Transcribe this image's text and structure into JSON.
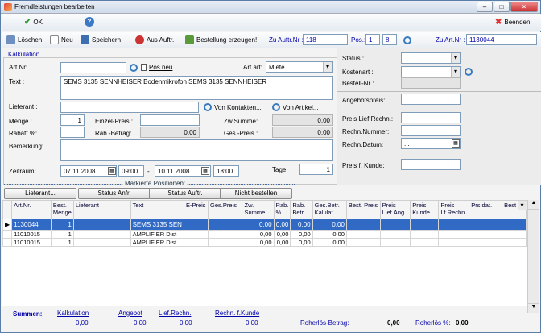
{
  "window": {
    "title": "Fremdleistungen bearbeiten"
  },
  "top": {
    "ok": "OK",
    "help": "?",
    "end": "Beenden"
  },
  "toolbar": {
    "delete": "Löschen",
    "new": "Neu",
    "save": "Speichern",
    "from_order": "Aus Auftr.",
    "create_order": "Bestellung erzeugen!",
    "order_no_label": "Zu Auftr.Nr :",
    "order_no": "118",
    "pos_label": "Pos.:",
    "pos1": "1",
    "pos2": "8",
    "art_no_label": "Zu Art.Nr :",
    "art_no": "1130044"
  },
  "form": {
    "section": "Kalkulation",
    "art_nr_label": "Art.Nr:",
    "pos_neu": "Pos.neu",
    "art_art_label": "Art.art:",
    "art_art": "Miete",
    "text_label": "Text :",
    "text": "SEMS 3135 SENNHEISER Bodenmikrofon SEMS 3135 SENNHEISER",
    "lieferant_label": "Lieferant :",
    "von_kontakten": "Von Kontakten...",
    "von_artikel": "Von Artikel...",
    "menge_label": "Menge :",
    "menge": "1",
    "einzelpreis_label": "Einzel-Preis :",
    "zw_summe_label": "Zw.Summe:",
    "zw_summe": "0,00",
    "rabatt_label": "Rabatt %:",
    "rab_betrag_label": "Rab.-Betrag:",
    "rab_betrag": "0,00",
    "ges_preis_label": "Ges.-Preis :",
    "ges_preis": "0,00",
    "bemerkung_label": "Bemerkung:",
    "zeitraum_label": "Zeitraum:",
    "date_from": "07.11.2008",
    "time_from": "09:00",
    "dash": "-",
    "date_to": "10.11.2008",
    "time_to": "18:00",
    "tage_label": "Tage:",
    "tage": "1"
  },
  "right": {
    "status_label": "Status :",
    "kostenart_label": "Kostenart :",
    "bestell_label": "Bestell-Nr :",
    "angebotspreis_label": "Angebotspreis:",
    "preis_lief_label": "Preis Lief.Rechn.:",
    "rechn_nummer_label": "Rechn.Nummer:",
    "rechn_datum_label": "Rechn.Datum:",
    "rechn_datum": ". .",
    "preis_kunde_label": "Preis f. Kunde:"
  },
  "marked": {
    "title": "Markierte Positionen:",
    "buttons": [
      "Lieferant...",
      "Status Anfr.",
      "Status Auftr.",
      "Nicht bestellen"
    ]
  },
  "grid": {
    "headers": [
      "",
      "Art.Nr.",
      "Best. Menge",
      "Lieferant",
      "Text",
      "E-Preis",
      "Ges.Preis",
      "Zw. Summe",
      "Rab. %",
      "Rab. Betr.",
      "Ges.Betr. Kalulat.",
      "Best. Preis",
      "Preis Lief.Ang.",
      "Preis Kunde",
      "Preis Lf.Rechn.",
      "Prs.dat.",
      "Best"
    ],
    "rows": [
      [
        "▶",
        "1130044",
        "1",
        "",
        "SEMS 3135 SEN",
        "",
        "",
        "0,00",
        "0,00",
        "0,00",
        "0,00",
        "",
        "",
        "",
        "",
        "",
        ""
      ],
      [
        "",
        "11010015",
        "1",
        "",
        "AMPLIFIER Dist",
        "",
        "",
        "0,00",
        "0,00",
        "0,00",
        "0,00",
        "",
        "",
        "",
        "",
        "",
        ""
      ],
      [
        "",
        "11010015",
        "1",
        "",
        "AMPLIFIER Dist",
        "",
        "",
        "0,00",
        "0,00",
        "0,00",
        "0,00",
        "",
        "",
        "",
        "",
        "",
        ""
      ]
    ]
  },
  "summary": {
    "label": "Summen:",
    "kalkulation": "Kalkulation",
    "angebot": "Angebot",
    "lief_rechn": "Lief.Rechn.",
    "rechn_kunde": "Rechn. f.Kunde",
    "v1": "0,00",
    "v2": "0,00",
    "v3": "0,00",
    "v4": "0,00",
    "roherloes_label": "Roherlös-Betrag:",
    "roherloes": "0,00",
    "roherloes_pct_label": "Roherlös %:",
    "roherloes_pct": "0,00"
  },
  "colors": {
    "selected": "#316ac5",
    "link": "#0000aa"
  }
}
